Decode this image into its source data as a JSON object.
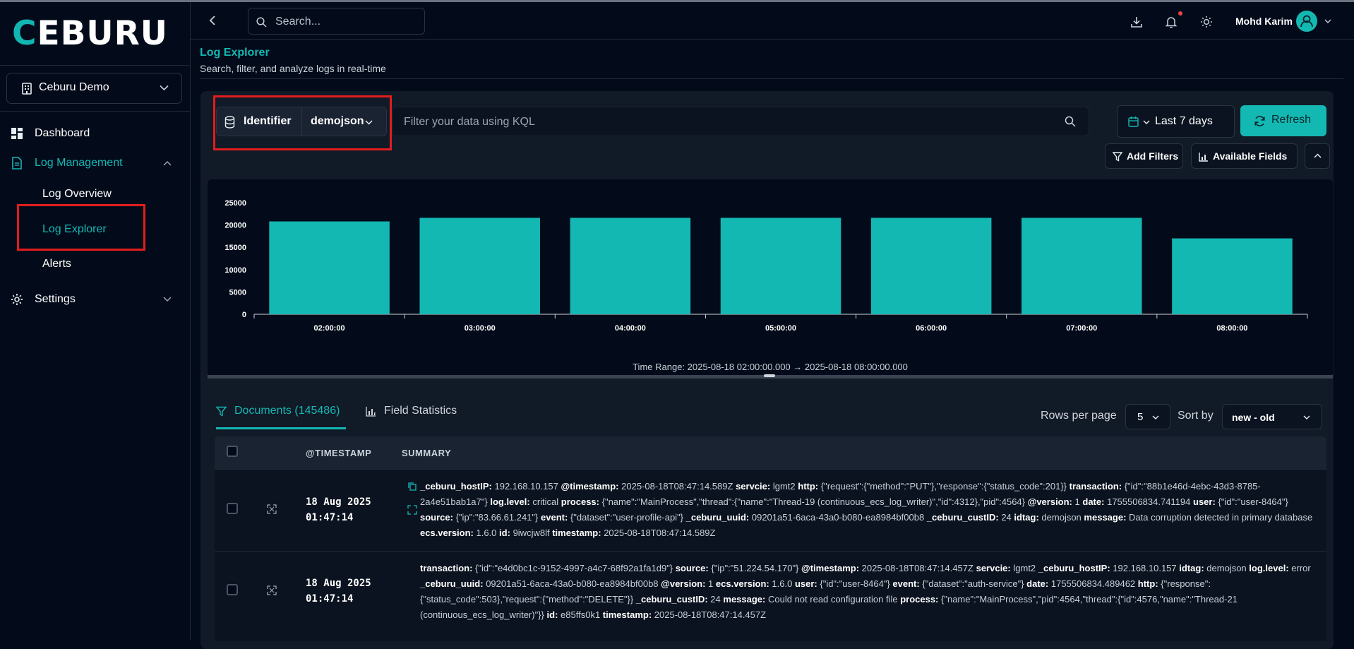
{
  "brand": {
    "logo_text": "CEBURU",
    "accent": "#14b8b3"
  },
  "sidebar": {
    "org": "Ceburu Demo",
    "items": [
      {
        "label": "Dashboard"
      },
      {
        "label": "Log Management"
      },
      {
        "label": "Settings"
      }
    ],
    "subitems": [
      {
        "label": "Log Overview"
      },
      {
        "label": "Log Explorer"
      },
      {
        "label": "Alerts"
      }
    ]
  },
  "header": {
    "search_placeholder": "Search...",
    "user_name": "Mohd Karim"
  },
  "page": {
    "title": "Log Explorer",
    "subtitle": "Search, filter, and analyze logs in real-time"
  },
  "query": {
    "identifier_label": "Identifier",
    "identifier_value": "demojson",
    "kql_placeholder": "Filter your data using KQL",
    "date_range": "Last 7 days",
    "refresh_label": "Refresh",
    "add_filters_label": "Add Filters",
    "available_fields_label": "Available Fields"
  },
  "chart_data": {
    "type": "bar",
    "categories": [
      "02:00:00",
      "03:00:00",
      "04:00:00",
      "05:00:00",
      "06:00:00",
      "07:00:00",
      "08:00:00"
    ],
    "values": [
      20800,
      21600,
      21600,
      21600,
      21600,
      21600,
      17000
    ],
    "yticks": [
      0,
      5000,
      10000,
      15000,
      20000,
      25000
    ],
    "ylim": [
      0,
      25000
    ],
    "color": "#14b8b3",
    "footer": "Time Range: 2025-08-18 02:00:00.000 → 2025-08-18 08:00:00.000"
  },
  "tabs": {
    "documents": "Documents (145486)",
    "field_statistics": "Field Statistics"
  },
  "pagination": {
    "rows_per_page_label": "Rows per page",
    "rows_per_page": "5",
    "sort_label": "Sort by",
    "sort_value": "new - old"
  },
  "table": {
    "columns": [
      "@TIMESTAMP",
      "SUMMARY"
    ],
    "rows": [
      {
        "date": "18 Aug 2025",
        "time": "01:47:14",
        "fields": [
          [
            "_ceburu_hostIP:",
            "192.168.10.157"
          ],
          [
            "@timestamp:",
            "2025-08-18T08:47:14.589Z"
          ],
          [
            "servcie:",
            "lgmt2"
          ],
          [
            "http:",
            "{\"request\":{\"method\":\"PUT\"},\"response\":{\"status_code\":201}}"
          ],
          [
            "transaction:",
            "{\"id\":\"88b1e46d-4ebc-43d3-8785-2a4e51bab1a7\"}"
          ],
          [
            "log.level:",
            "critical"
          ],
          [
            "process:",
            "{\"name\":\"MainProcess\",\"thread\":{\"name\":\"Thread-19 (continuous_ecs_log_writer)\",\"id\":4312},\"pid\":4564}"
          ],
          [
            "@version:",
            "1"
          ],
          [
            "date:",
            "1755506834.741194"
          ],
          [
            "user:",
            "{\"id\":\"user-8464\"}"
          ],
          [
            "source:",
            "{\"ip\":\"83.66.61.241\"}"
          ],
          [
            "event:",
            "{\"dataset\":\"user-profile-api\"}"
          ],
          [
            "_ceburu_uuid:",
            "09201a51-6aca-43a0-b080-ea8984bf00b8"
          ],
          [
            "_ceburu_custID:",
            "24"
          ],
          [
            "idtag:",
            "demojson"
          ],
          [
            "message:",
            "Data corruption detected in primary database"
          ],
          [
            "ecs.version:",
            "1.6.0"
          ],
          [
            "id:",
            "9iwcjw8lf"
          ],
          [
            "timestamp:",
            "2025-08-18T08:47:14.589Z"
          ]
        ]
      },
      {
        "date": "18 Aug 2025",
        "time": "01:47:14",
        "fields": [
          [
            "transaction:",
            "{\"id\":\"e4d0bc1c-9152-4997-a4c7-68f92a1fa1d9\"}"
          ],
          [
            "source:",
            "{\"ip\":\"51.224.54.170\"}"
          ],
          [
            "@timestamp:",
            "2025-08-18T08:47:14.457Z"
          ],
          [
            "servcie:",
            "lgmt2"
          ],
          [
            "_ceburu_hostIP:",
            "192.168.10.157"
          ],
          [
            "idtag:",
            "demojson"
          ],
          [
            "log.level:",
            "error"
          ],
          [
            "_ceburu_uuid:",
            "09201a51-6aca-43a0-b080-ea8984bf00b8"
          ],
          [
            "@version:",
            "1"
          ],
          [
            "ecs.version:",
            "1.6.0"
          ],
          [
            "user:",
            "{\"id\":\"user-8464\"}"
          ],
          [
            "event:",
            "{\"dataset\":\"auth-service\"}"
          ],
          [
            "date:",
            "1755506834.489462"
          ],
          [
            "http:",
            "{\"response\":{\"status_code\":503},\"request\":{\"method\":\"DELETE\"}}"
          ],
          [
            "_ceburu_custID:",
            "24"
          ],
          [
            "message:",
            "Could not read configuration file"
          ],
          [
            "process:",
            "{\"name\":\"MainProcess\",\"pid\":4564,\"thread\":{\"id\":4576,\"name\":\"Thread-21 (continuous_ecs_log_writer)\"}}"
          ],
          [
            "id:",
            "e85ffs0k1"
          ],
          [
            "timestamp:",
            "2025-08-18T08:47:14.457Z"
          ]
        ]
      }
    ]
  }
}
